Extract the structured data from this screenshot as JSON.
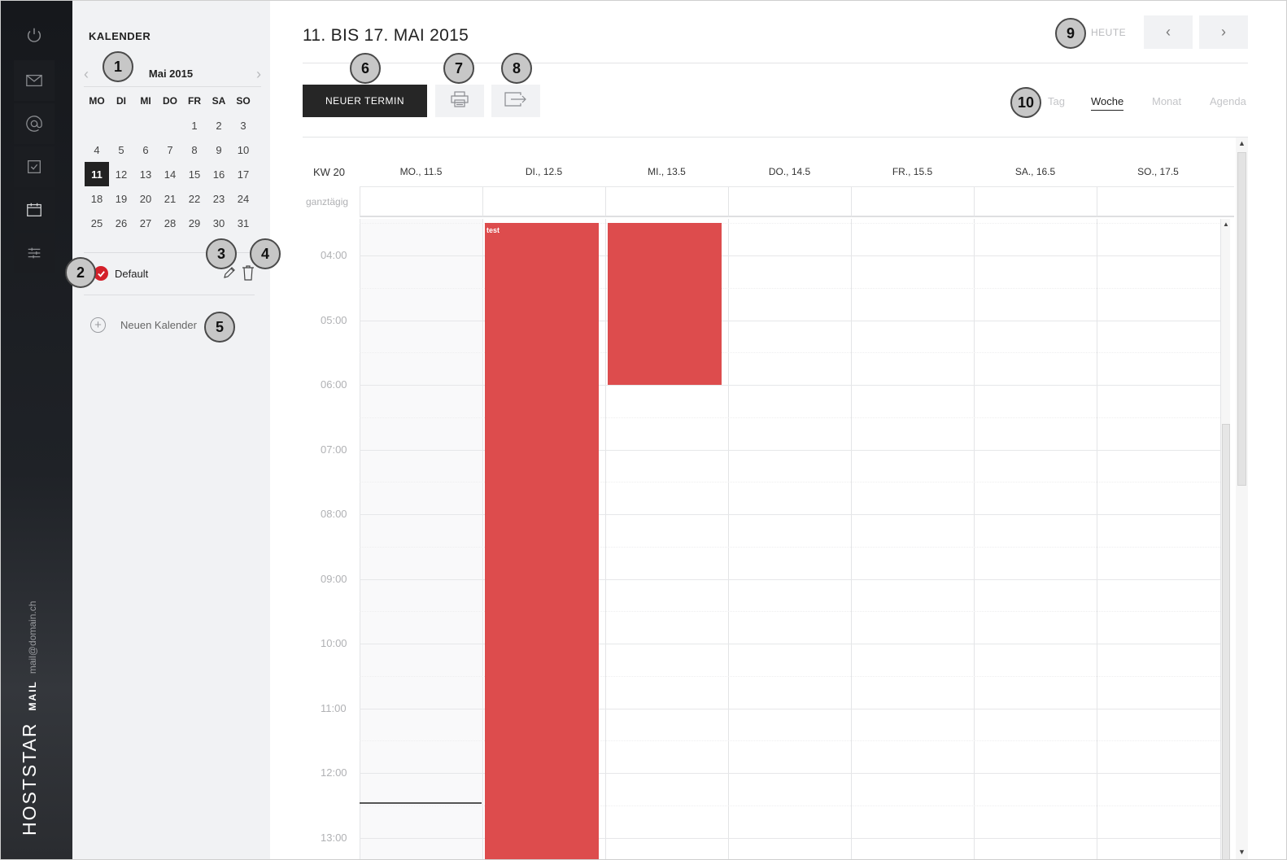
{
  "rail": {
    "items": [
      {
        "icon": "power-icon"
      },
      {
        "icon": "mail-icon"
      },
      {
        "icon": "at-icon"
      },
      {
        "icon": "tasks-icon"
      },
      {
        "icon": "calendar-icon"
      },
      {
        "icon": "settings-sliders-icon"
      }
    ],
    "brand": "HOSTSTAR",
    "brand_mail": "MAIL",
    "account": "mail@domain.ch"
  },
  "sidebar": {
    "title": "KALENDER",
    "mini_calendar": {
      "title": "Mai 2015",
      "weekdays": [
        "MO",
        "DI",
        "MI",
        "DO",
        "FR",
        "SA",
        "SO"
      ],
      "weeks": [
        [
          "",
          "",
          "",
          "",
          "1",
          "2",
          "3"
        ],
        [
          "4",
          "5",
          "6",
          "7",
          "8",
          "9",
          "10"
        ],
        [
          "11",
          "12",
          "13",
          "14",
          "15",
          "16",
          "17"
        ],
        [
          "18",
          "19",
          "20",
          "21",
          "22",
          "23",
          "24"
        ],
        [
          "25",
          "26",
          "27",
          "28",
          "29",
          "30",
          "31"
        ]
      ],
      "selected": "11"
    },
    "calendars": [
      {
        "name": "Default",
        "color": "#d4202a",
        "checked": true
      }
    ],
    "new_calendar_label": "Neuen Kalender"
  },
  "header": {
    "title": "11. BIS 17. MAI 2015",
    "today_label": "HEUTE",
    "prev_icon": "chevron-left-icon",
    "next_icon": "chevron-right-icon"
  },
  "toolbar": {
    "new_event_label": "NEUER TERMIN",
    "print_icon": "printer-icon",
    "export_icon": "export-icon",
    "views": [
      "Tag",
      "Woche",
      "Monat",
      "Agenda"
    ],
    "active_view": "Woche"
  },
  "week": {
    "week_label": "KW 20",
    "allday_label": "ganztägig",
    "days": [
      "MO., 11.5",
      "DI., 12.5",
      "MI., 13.5",
      "DO., 14.5",
      "FR., 15.5",
      "SA., 16.5",
      "SO., 17.5"
    ],
    "hours": [
      "04:00",
      "05:00",
      "06:00",
      "07:00",
      "08:00",
      "09:00",
      "10:00",
      "11:00",
      "12:00",
      "13:00"
    ],
    "events": [
      {
        "day": 1,
        "title": "test",
        "start": "03:30",
        "end": "13:45",
        "color": "#dd4c4d"
      },
      {
        "day": 2,
        "title": "",
        "start": "03:30",
        "end": "06:00",
        "color": "#dd4c4d"
      }
    ],
    "current_time": "12:27"
  },
  "callouts": [
    "1",
    "2",
    "3",
    "4",
    "5",
    "6",
    "7",
    "8",
    "9",
    "10"
  ]
}
